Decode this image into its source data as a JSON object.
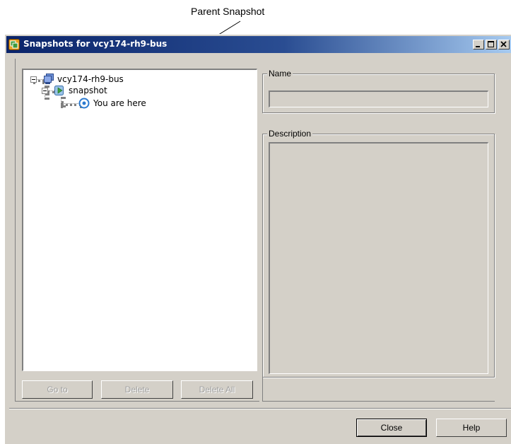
{
  "callout": {
    "label": "Parent Snapshot"
  },
  "window": {
    "title": "Snapshots for vcy174-rh9-bus"
  },
  "tree": {
    "root": {
      "label": "vcy174-rh9-bus",
      "icon": "vm-icon"
    },
    "snapshot": {
      "label": "snapshot",
      "icon": "snapshot-icon"
    },
    "current": {
      "label": "You are here",
      "icon": "you-are-here-icon"
    }
  },
  "tree_buttons": {
    "goto": "Go to",
    "delete": "Delete",
    "delete_all": "Delete All"
  },
  "details": {
    "name_label": "Name",
    "name_value": "",
    "description_label": "Description",
    "description_value": ""
  },
  "footer": {
    "close": "Close",
    "help": "Help"
  }
}
